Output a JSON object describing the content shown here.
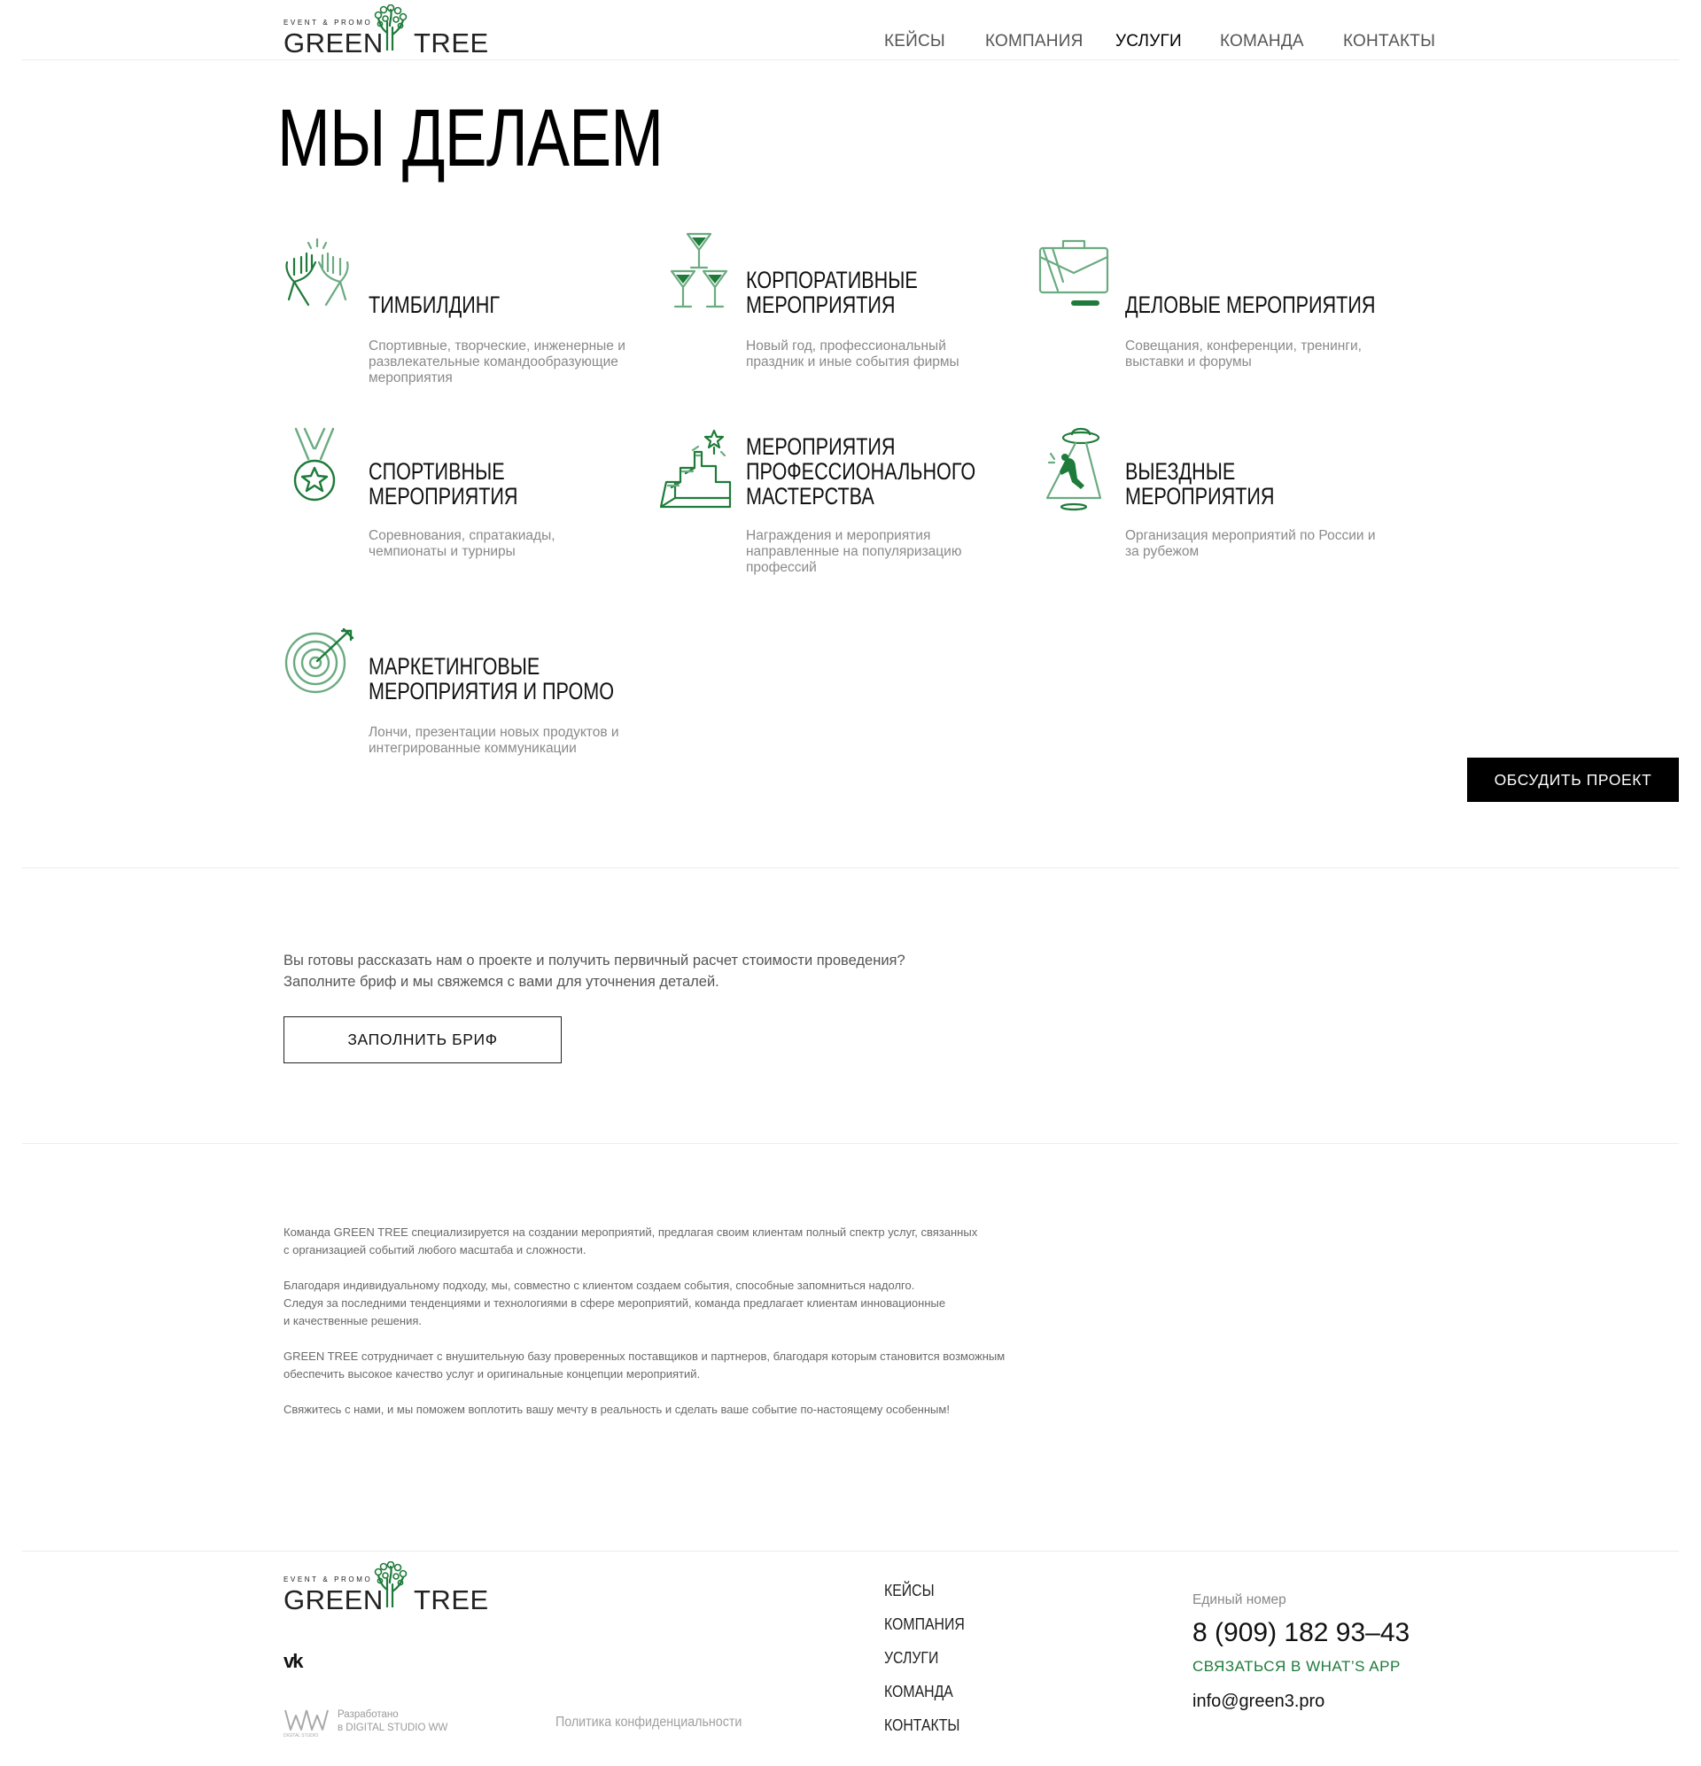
{
  "brand": {
    "tagline": "EVENT & PROMO",
    "word1": "GREEN",
    "word2": "TREE",
    "accent_color": "#1e7b3a",
    "icon_light_color": "#6aab80"
  },
  "nav": {
    "items": [
      {
        "label": "КЕЙСЫ",
        "active": false
      },
      {
        "label": "КОМПАНИЯ",
        "active": false
      },
      {
        "label": "УСЛУГИ",
        "active": true
      },
      {
        "label": "КОМАНДА",
        "active": false
      },
      {
        "label": "КОНТАКТЫ",
        "active": false
      }
    ]
  },
  "hero": {
    "title": "МЫ ДЕЛАЕМ"
  },
  "services": [
    {
      "icon": "high-five-icon",
      "title_lines": [
        "ТИМБИЛДИНГ"
      ],
      "description": "Спортивные, творческие, инженерные и развлекательные командообразующие мероприятия"
    },
    {
      "icon": "cocktail-glasses-icon",
      "title_lines": [
        "КОРПОРАТИВНЫЕ",
        "МЕРОПРИЯТИЯ"
      ],
      "description": "Новый год, профессиональный праздник и иные события фирмы"
    },
    {
      "icon": "briefcase-icon",
      "title_lines": [
        "ДЕЛОВЫЕ МЕРОПРИЯТИЯ"
      ],
      "description": "Совещания, конференции, тренинги, выставки и форумы"
    },
    {
      "icon": "medal-icon",
      "title_lines": [
        "СПОРТИВНЫЕ",
        "МЕРОПРИЯТИЯ"
      ],
      "description": "Соревнования, спратакиады, чемпионаты и турниры"
    },
    {
      "icon": "stairs-star-icon",
      "title_lines": [
        "МЕРОПРИЯТИЯ",
        "ПРОФЕССИОНАЛЬНОГО",
        "МАСТЕРСТВА"
      ],
      "description": "Награждения и мероприятия направленные на популяризацию профессий"
    },
    {
      "icon": "ufo-abduction-icon",
      "title_lines": [
        "ВЫЕЗДНЫЕ",
        "МЕРОПРИЯТИЯ"
      ],
      "description": "Организация мероприятий по России и за рубежом"
    },
    {
      "icon": "target-dart-icon",
      "title_lines": [
        "МАРКЕТИНГОВЫЕ",
        "МЕРОПРИЯТИЯ И ПРОМО"
      ],
      "description": "Лончи, презентации новых продуктов и интегрированные коммуникации"
    }
  ],
  "cta": {
    "discuss_label": "ОБСУДИТЬ ПРОЕКТ",
    "brief_line1": "Вы готовы рассказать нам о проекте и получить первичный расчет стоимости проведения?",
    "brief_line2": "Заполните бриф и мы свяжемся с вами для уточнения деталей.",
    "brief_button": "ЗАПОЛНИТЬ БРИФ"
  },
  "about": {
    "paragraphs": [
      [
        "Команда GREEN TREE специализируется на создании мероприятий, предлагая своим клиентам полный спектр услуг, связанных",
        "с организацией событий  любого масштаба и сложности."
      ],
      [
        "Благодаря индивидуальному подходу, мы, совместно с клиентом создаем события, способные запомниться надолго.",
        "Следуя за последними тенденциями и технологиями в сфере мероприятий, команда предлагает клиентам инновационные",
        "и качественные решения."
      ],
      [
        "GREEN TREE сотрудничает с внушительную базу проверенных поставщиков и партнеров, благодаря которым становится возможным",
        "обеспечить высокое качество услуг и оригинальные концепции мероприятий."
      ],
      [
        "Свяжитесь с нами, и мы поможем воплотить вашу мечту в реальность и сделать ваше событие по-настоящему особенным!"
      ]
    ]
  },
  "footer": {
    "social_icon": "vk-icon",
    "social_label": "vk",
    "studio_mark_text": "WW",
    "studio_mark_caption": "DIGITAL STUDIO",
    "studio_line1": "Разработано",
    "studio_line2": "в DIGITAL STUDIO WW",
    "policy": "Политика конфиденциальности",
    "nav": [
      "КЕЙСЫ",
      "КОМПАНИЯ",
      "УСЛУГИ",
      "КОМАНДА",
      "КОНТАКТЫ"
    ],
    "phone_label": "Единый номер",
    "phone": "8 (909) 182 93–43",
    "whatsapp": "СВЯЗАТЬСЯ В WHAT’S APP",
    "email": "info@green3.pro"
  }
}
